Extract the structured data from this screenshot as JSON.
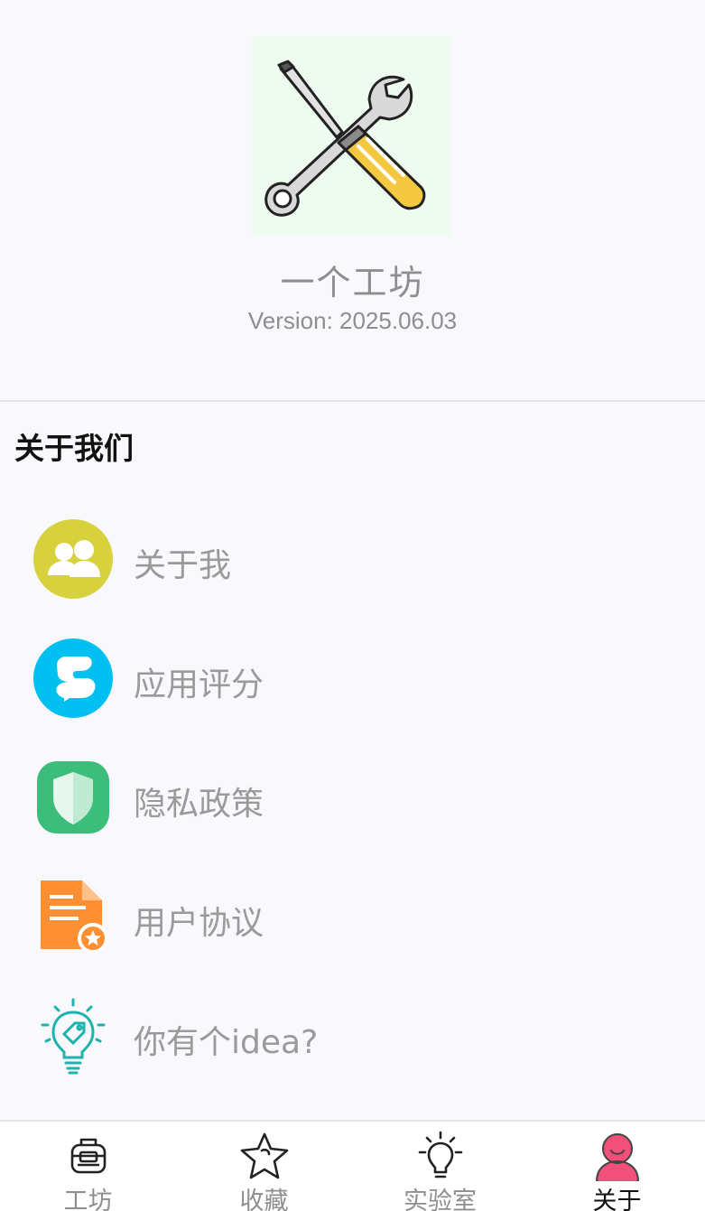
{
  "app": {
    "name": "一个工坊",
    "version": "Version: 2025.06.03"
  },
  "section": {
    "title": "关于我们"
  },
  "menu": [
    {
      "label": "关于我",
      "icon": "users-icon",
      "color": "#d6d13c"
    },
    {
      "label": "应用评分",
      "icon": "chat-bubble-icon",
      "color": "#00c0f2"
    },
    {
      "label": "隐私政策",
      "icon": "shield-icon",
      "color": "#3dbd7a"
    },
    {
      "label": "用户协议",
      "icon": "document-star-icon",
      "color": "#ff8f33"
    },
    {
      "label": "你有个idea?",
      "icon": "lightbulb-tag-icon",
      "color": "#1db4ae"
    }
  ],
  "nav": [
    {
      "label": "工坊",
      "icon": "toolbox-icon",
      "active": false
    },
    {
      "label": "收藏",
      "icon": "star-icon",
      "active": false
    },
    {
      "label": "实验室",
      "icon": "lightbulb-icon",
      "active": false
    },
    {
      "label": "关于",
      "icon": "user-icon",
      "active": true,
      "accent": "#f0507a"
    }
  ]
}
